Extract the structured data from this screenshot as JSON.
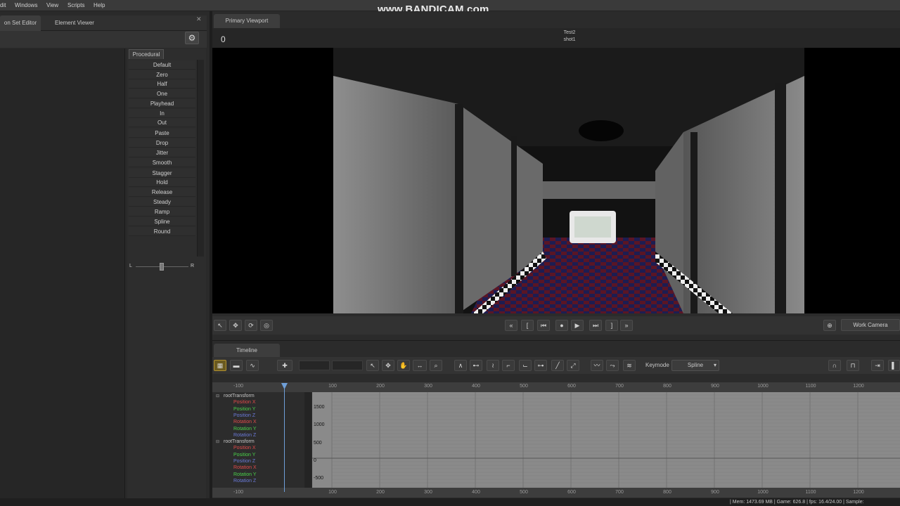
{
  "watermark": "www.BANDICAM.com",
  "menu": [
    "dit",
    "Windows",
    "View",
    "Scripts",
    "Help"
  ],
  "left_tabs": [
    "on Set Editor",
    "Element Viewer"
  ],
  "procedural": {
    "tab_label": "Procedural",
    "buttons": [
      "Default",
      "Zero",
      "Half",
      "One",
      "Playhead",
      "In",
      "Out",
      "Paste",
      "Drop",
      "Jitter",
      "Smooth",
      "Stagger",
      "Hold",
      "Release",
      "Steady",
      "Ramp",
      "Spline",
      "Round"
    ],
    "slider_left": "L",
    "slider_right": "R"
  },
  "viewport": {
    "tab_label": "Primary Viewport",
    "frame_number": "0",
    "scene_name": "Test2",
    "shot_name": "shot1",
    "work_camera_label": "Work Camera"
  },
  "timeline": {
    "tab_label": "Timeline",
    "keymode_label": "Keymode",
    "keymode_value": "Spline",
    "ruler_ticks": [
      "-100",
      "100",
      "200",
      "300",
      "400",
      "500",
      "600",
      "700",
      "800",
      "900",
      "1000",
      "1100",
      "1200"
    ],
    "y_labels": [
      "1500",
      "1000",
      "500",
      "0",
      "-500"
    ],
    "channels": [
      {
        "label": "rootTransform",
        "kind": "group"
      },
      {
        "label": "Position X",
        "kind": "x"
      },
      {
        "label": "Position Y",
        "kind": "y"
      },
      {
        "label": "Position Z",
        "kind": "z"
      },
      {
        "label": "Rotation X",
        "kind": "x"
      },
      {
        "label": "Rotation Y",
        "kind": "y"
      },
      {
        "label": "Rotation Z",
        "kind": "z"
      },
      {
        "label": "rootTransform",
        "kind": "group"
      },
      {
        "label": "Position X",
        "kind": "x"
      },
      {
        "label": "Position Y",
        "kind": "y"
      },
      {
        "label": "Position Z",
        "kind": "z"
      },
      {
        "label": "Rotation X",
        "kind": "x"
      },
      {
        "label": "Rotation Y",
        "kind": "y"
      },
      {
        "label": "Rotation Z",
        "kind": "z"
      }
    ]
  },
  "status": "| Mem: 1473.69 MB | Game: 626.8 | fps: 16.4/24.00 | Sample:",
  "colors": {
    "x": "#e04a4a",
    "y": "#4ad04a",
    "z": "#6a7ad8",
    "group": "#c8c8c8",
    "accent": "#6f9fd8"
  }
}
